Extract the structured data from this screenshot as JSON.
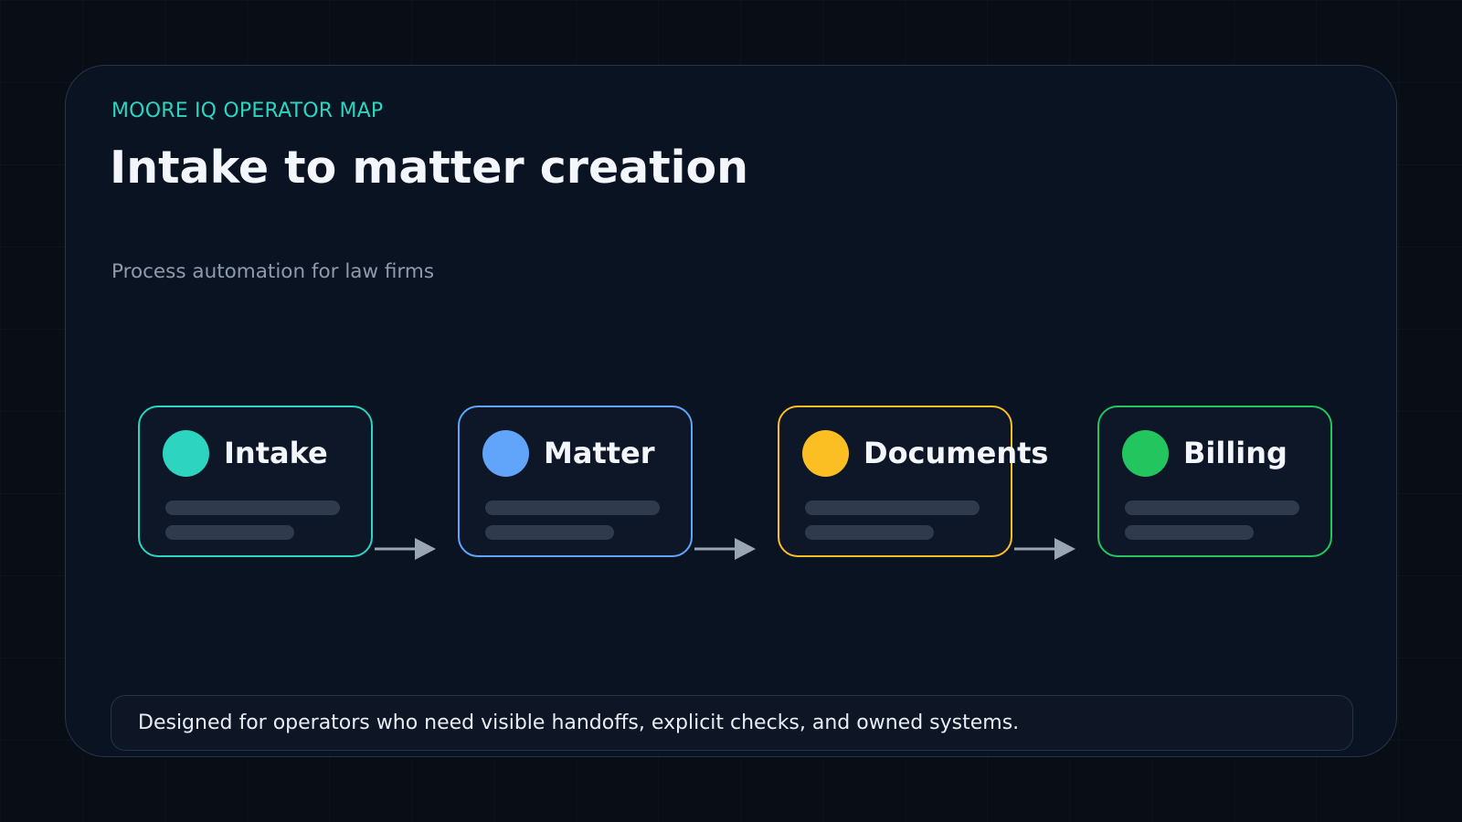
{
  "header": {
    "eyebrow": "MOORE IQ OPERATOR MAP",
    "title": "Intake to matter creation",
    "subtitle": "Process automation for law firms"
  },
  "stages": [
    {
      "label": "Intake",
      "color": "#2dd4bf"
    },
    {
      "label": "Matter",
      "color": "#60a5fa"
    },
    {
      "label": "Documents",
      "color": "#fbbf24"
    },
    {
      "label": "Billing",
      "color": "#22c55e"
    }
  ],
  "colors": {
    "eyebrow": "#2dd4bf",
    "arrow": "#9aa5b4"
  },
  "footer": {
    "text": "Designed for operators who need visible handoffs, explicit checks, and owned systems."
  }
}
